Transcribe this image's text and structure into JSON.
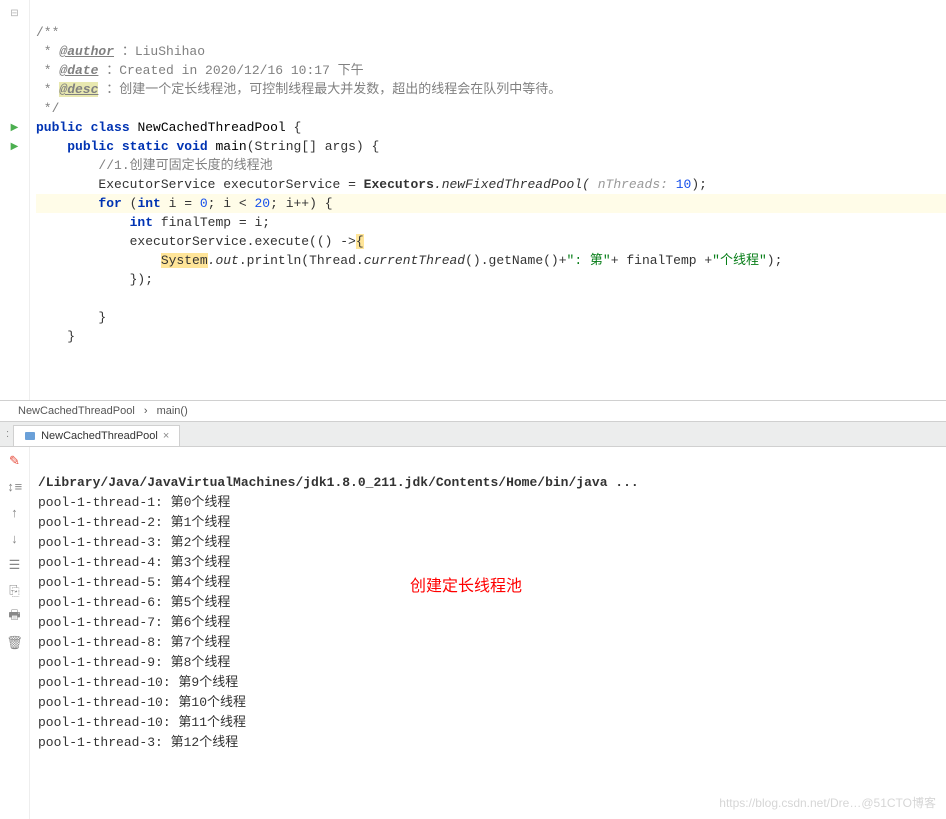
{
  "doc": {
    "open": "/**",
    "author_tag": "@author",
    "author_val": "：LiuShihao",
    "date_tag": "@date",
    "date_val": "：Created in 2020/12/16 10:17 下午",
    "desc_tag": "@desc",
    "desc_val": "：创建一个定长线程池，可控制线程最大并发数，超出的线程会在队列中等待。",
    "close": " */"
  },
  "code": {
    "public": "public",
    "class": "class",
    "clsName": "NewCachedThreadPool",
    "static": "static",
    "void": "void",
    "main": "main",
    "args": "(String[] args) {",
    "comment1": "//1.创建可固定长度的线程池",
    "es": "ExecutorService executorService = ",
    "executors": "Executors",
    "newFixed": ".newFixedThreadPool(",
    "hint": " nThreads: ",
    "ten": "10",
    "endcall": ");",
    "for": "for",
    "forCond1": " (",
    "int": "int",
    "forCond2": " i = ",
    "zero": "0",
    "forCond3": "; i < ",
    "twenty": "20",
    "forCond4": "; i++) {",
    "finalTemp1": " finalTemp = i;",
    "execute": "executorService.execute(() ->",
    "lb": "{",
    "sys": "System",
    "out": ".out",
    "println": ".println(Thread.",
    "currentThread": "currentThread",
    "getName": "().getName()+",
    "str1": "\": 第\"",
    "plus": "+ finalTemp +",
    "str2": "\"个线程\"",
    "endln": ");",
    "closeLambda": "});",
    "closeBrace": "}"
  },
  "breadcrumb": {
    "a": "NewCachedThreadPool",
    "b": "main()"
  },
  "tab": {
    "name": "NewCachedThreadPool"
  },
  "console": {
    "cmd": "/Library/Java/JavaVirtualMachines/jdk1.8.0_211.jdk/Contents/Home/bin/java ...",
    "lines": [
      "pool-1-thread-1: 第0个线程",
      "pool-1-thread-2: 第1个线程",
      "pool-1-thread-3: 第2个线程",
      "pool-1-thread-4: 第3个线程",
      "pool-1-thread-5: 第4个线程",
      "pool-1-thread-6: 第5个线程",
      "pool-1-thread-7: 第6个线程",
      "pool-1-thread-8: 第7个线程",
      "pool-1-thread-9: 第8个线程",
      "pool-1-thread-10: 第9个线程",
      "pool-1-thread-10: 第10个线程",
      "pool-1-thread-10: 第11个线程",
      "pool-1-thread-3: 第12个线程"
    ]
  },
  "annotation": "创建定长线程池",
  "watermark": "https://blog.csdn.net/Dre…@51CTO博客"
}
